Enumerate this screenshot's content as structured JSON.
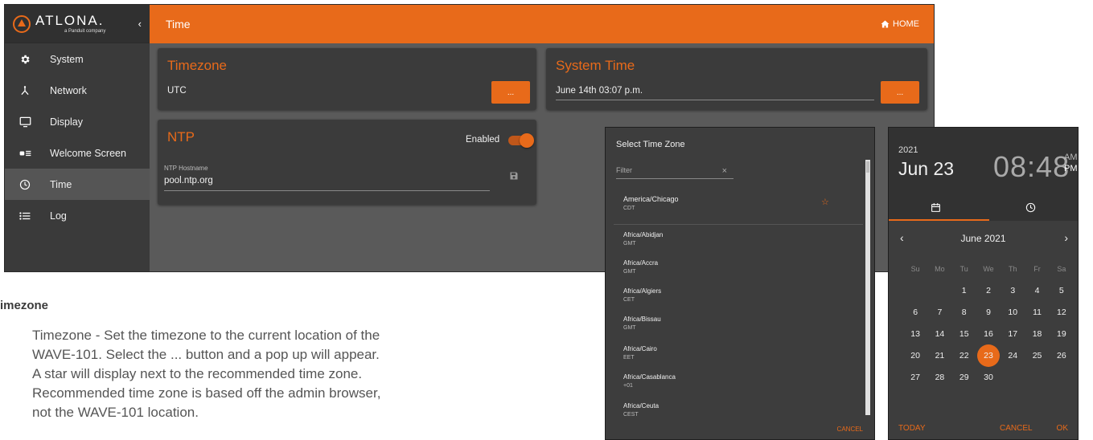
{
  "brand": {
    "name": "ATLONA.",
    "sub": "a Panduit company",
    "collapse_glyph": "‹"
  },
  "nav": [
    {
      "label": "System",
      "icon": "gear-icon"
    },
    {
      "label": "Network",
      "icon": "network-icon"
    },
    {
      "label": "Display",
      "icon": "monitor-icon"
    },
    {
      "label": "Welcome Screen",
      "icon": "welcome-screen-icon"
    },
    {
      "label": "Time",
      "icon": "clock-icon",
      "active": true
    },
    {
      "label": "Log",
      "icon": "list-icon"
    }
  ],
  "header": {
    "title": "Time",
    "home_label": "HOME"
  },
  "timezone_card": {
    "title": "Timezone",
    "value": "UTC",
    "button_label": "..."
  },
  "system_time_card": {
    "title": "System Time",
    "value": "June 14th 03:07 p.m.",
    "button_label": "..."
  },
  "ntp_card": {
    "title": "NTP",
    "toggle_label": "Enabled",
    "enabled": true,
    "hostname_label": "NTP Hostname",
    "hostname_value": "pool.ntp.org"
  },
  "doc": {
    "heading": "imezone",
    "lines": [
      "Timezone - Set the timezone to the current location of the",
      "WAVE-101. Select the ... button and a pop up will appear.",
      "A star will display next to the recommended time zone.",
      "Recommended time zone is based off the admin browser,",
      "not the WAVE-101 location."
    ]
  },
  "tz_dialog": {
    "title": "Select Time Zone",
    "filter_placeholder": "Filter",
    "clear_glyph": "×",
    "recommended": {
      "name": "America/Chicago",
      "abbr": "CDT"
    },
    "zones": [
      {
        "name": "Africa/Abidjan",
        "abbr": "GMT"
      },
      {
        "name": "Africa/Accra",
        "abbr": "GMT"
      },
      {
        "name": "Africa/Algiers",
        "abbr": "CET"
      },
      {
        "name": "Africa/Bissau",
        "abbr": "GMT"
      },
      {
        "name": "Africa/Cairo",
        "abbr": "EET"
      },
      {
        "name": "Africa/Casablanca",
        "abbr": "+01"
      },
      {
        "name": "Africa/Ceuta",
        "abbr": "CEST"
      }
    ],
    "cancel_label": "CANCEL"
  },
  "date_picker": {
    "year": "2021",
    "date": "Jun 23",
    "time": "08:48",
    "am": "AM",
    "pm": "PM",
    "month_label": "June 2021",
    "weekdays": [
      "Su",
      "Mo",
      "Tu",
      "We",
      "Th",
      "Fr",
      "Sa"
    ],
    "weeks": [
      [
        "",
        "",
        "1",
        "2",
        "3",
        "4",
        "5"
      ],
      [
        "6",
        "7",
        "8",
        "9",
        "10",
        "11",
        "12"
      ],
      [
        "13",
        "14",
        "15",
        "16",
        "17",
        "18",
        "19"
      ],
      [
        "20",
        "21",
        "22",
        "23",
        "24",
        "25",
        "26"
      ],
      [
        "27",
        "28",
        "29",
        "30",
        "",
        "",
        ""
      ]
    ],
    "selected_day": "23",
    "today_label": "TODAY",
    "cancel_label": "CANCEL",
    "ok_label": "OK"
  },
  "colors": {
    "accent": "#e86a1a",
    "sidebar": "#3a3a3a",
    "content_bg": "#5a5a5a",
    "card": "#3b3b3b"
  }
}
